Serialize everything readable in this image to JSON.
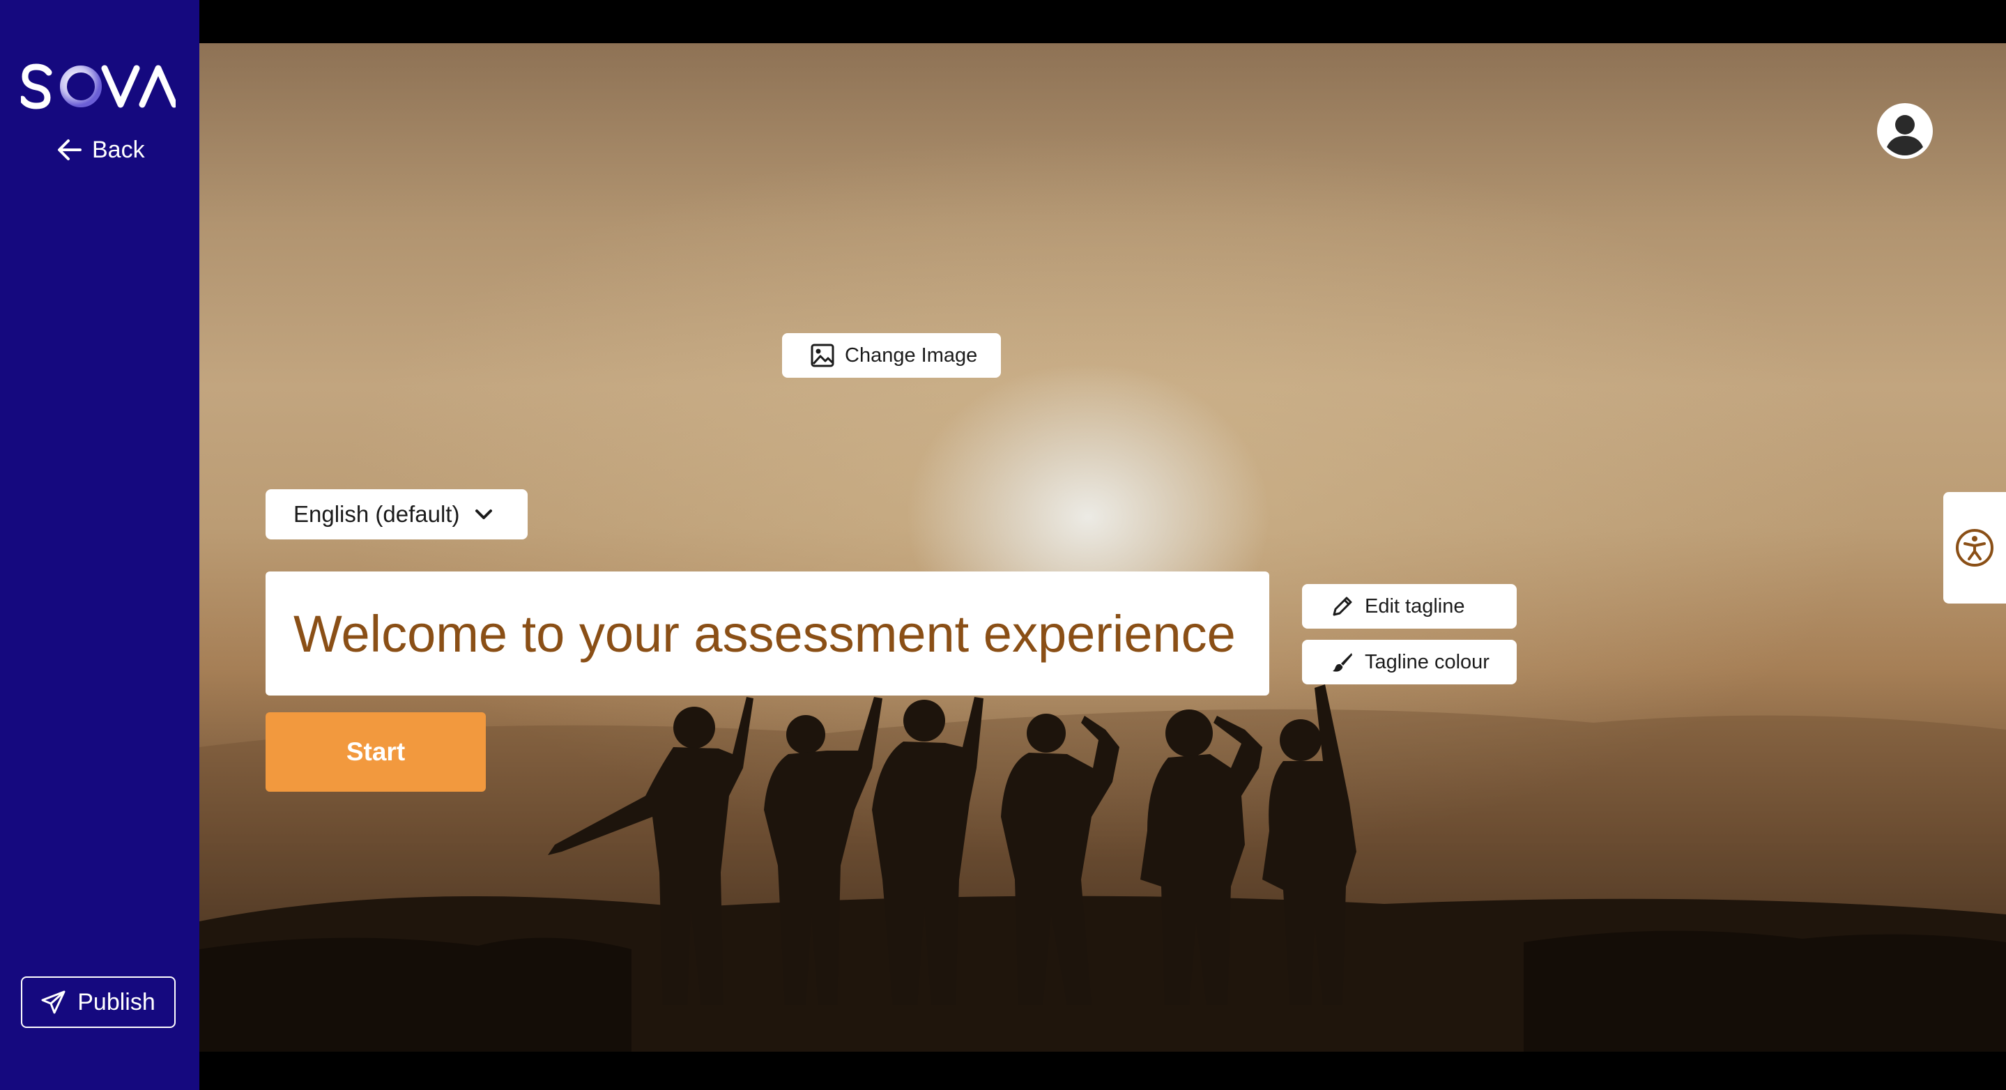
{
  "sidebar": {
    "logo_text": "SOVA",
    "back_label": "Back",
    "publish_label": "Publish",
    "background_color": "#15097f"
  },
  "stage": {
    "change_image_label": "Change Image",
    "language_selected": "English (default)",
    "tagline": "Welcome to your assessment experience",
    "tagline_color": "#8a4f16",
    "edit_tagline_label": "Edit tagline",
    "tagline_colour_label": "Tagline colour",
    "start_label": "Start",
    "start_color": "#f2993e"
  },
  "icons": {
    "back": "arrow-left-icon",
    "publish": "paper-plane-icon",
    "change_image": "image-icon",
    "language": "chevron-down-icon",
    "edit_tagline": "pencil-icon",
    "tagline_colour": "brush-icon",
    "user": "user-avatar-icon",
    "accessibility": "accessibility-icon"
  }
}
